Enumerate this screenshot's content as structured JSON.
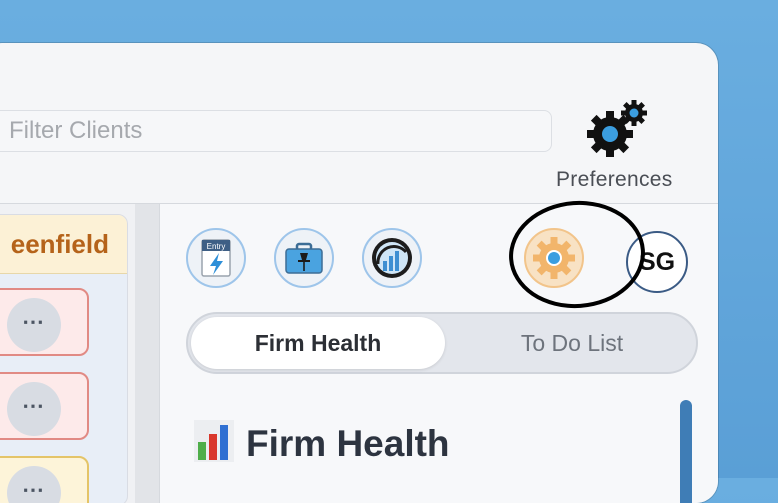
{
  "search": {
    "placeholder": "Filter Clients"
  },
  "preferences": {
    "label": "Preferences",
    "icon": "gears-icon"
  },
  "board": {
    "column_title": "eenfield",
    "cards": [
      {
        "status": "red",
        "menu": "⋯"
      },
      {
        "status": "red",
        "menu": "⋯"
      },
      {
        "status": "yellow",
        "menu": "⋯"
      }
    ]
  },
  "toolbar": {
    "tools": [
      {
        "name": "entry-icon",
        "caption": "Entry"
      },
      {
        "name": "briefcase-pin-icon"
      },
      {
        "name": "gauge-chart-icon"
      },
      {
        "name": "settings-gear-icon"
      }
    ],
    "avatar_initials": "SG"
  },
  "tabs": [
    {
      "label": "Firm Health",
      "active": true
    },
    {
      "label": "To Do List",
      "active": false
    }
  ],
  "section": {
    "title": "Firm Health",
    "icon": "bar-chart-icon"
  },
  "colors": {
    "accent_blue": "#3b9ee0",
    "column_header_text": "#b5631a",
    "gear_orange": "#f2b56b"
  }
}
